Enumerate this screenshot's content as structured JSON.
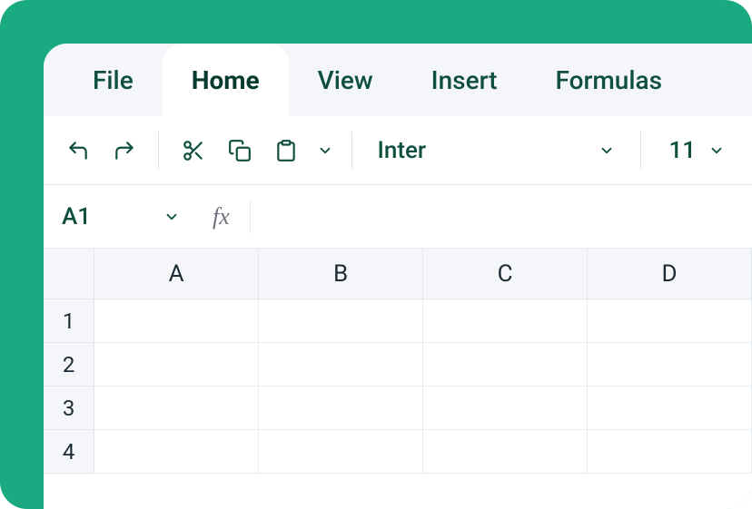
{
  "tabs": {
    "file": "File",
    "home": "Home",
    "view": "View",
    "insert": "Insert",
    "formulas": "Formulas"
  },
  "toolbar": {
    "font_name": "Inter",
    "font_size": "11"
  },
  "formula_bar": {
    "cell_ref": "A1",
    "fx_label": "fx",
    "formula_value": ""
  },
  "grid": {
    "columns": {
      "c0": "A",
      "c1": "B",
      "c2": "C",
      "c3": "D"
    },
    "rows": {
      "r0": "1",
      "r1": "2",
      "r2": "3",
      "r3": "4"
    }
  },
  "colors": {
    "brand_green": "#1aaa81",
    "text_dark": "#0f4f40"
  }
}
